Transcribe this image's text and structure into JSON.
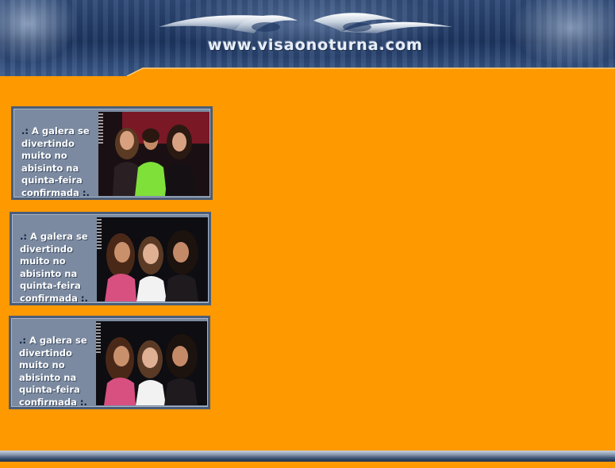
{
  "header": {
    "logo_text": "www.visaonoturna.com",
    "logo_icon": "swoosh-logo-icon"
  },
  "colors": {
    "page_background": "#ff9900",
    "card_frame": "#7b8aa0",
    "caption_text": "#ffffff",
    "caption_marker": "#0d1b3a",
    "header_blue": "#1d3560"
  },
  "gallery": {
    "cards": [
      {
        "caption_prefix": ".:",
        "caption": "A galera se divertindo muito no abisinto na quinta-feira confirmada",
        "caption_suffix": ":.",
        "photo": "photo-three-women-club"
      },
      {
        "caption_prefix": ".:",
        "caption": "A galera se divertindo muito no abisinto na quinta-feira confirmada",
        "caption_suffix": ":.",
        "photo": "photo-three-women-dark"
      },
      {
        "caption_prefix": ".:",
        "caption": "A galera se divertindo muito no abisinto na quinta-feira confirmada",
        "caption_suffix": ":.",
        "photo": "photo-three-women-dark"
      }
    ]
  }
}
